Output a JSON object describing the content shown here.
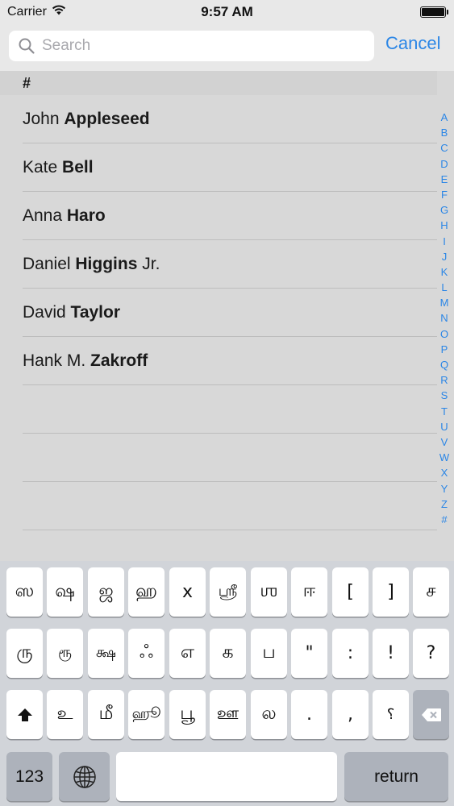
{
  "status_bar": {
    "carrier": "Carrier",
    "time": "9:57 AM"
  },
  "search": {
    "placeholder": "Search",
    "cancel_label": "Cancel"
  },
  "list": {
    "section_header": "#",
    "rows": [
      {
        "first": "John",
        "last": "Appleseed",
        "suffix": ""
      },
      {
        "first": "Kate",
        "last": "Bell",
        "suffix": ""
      },
      {
        "first": "Anna",
        "last": "Haro",
        "suffix": ""
      },
      {
        "first": "Daniel",
        "last": "Higgins",
        "suffix": "Jr."
      },
      {
        "first": "David",
        "last": "Taylor",
        "suffix": ""
      },
      {
        "first": "Hank M.",
        "last": "Zakroff",
        "suffix": ""
      },
      {
        "first": "",
        "last": "",
        "suffix": ""
      },
      {
        "first": "",
        "last": "",
        "suffix": ""
      },
      {
        "first": "",
        "last": "",
        "suffix": ""
      }
    ],
    "index_letters": [
      "A",
      "B",
      "C",
      "D",
      "E",
      "F",
      "G",
      "H",
      "I",
      "J",
      "K",
      "L",
      "M",
      "N",
      "O",
      "P",
      "Q",
      "R",
      "S",
      "T",
      "U",
      "V",
      "W",
      "X",
      "Y",
      "Z",
      "#"
    ]
  },
  "keyboard": {
    "row1": [
      "ஸ",
      "ஷ",
      "ஜ",
      "ஹ",
      "x",
      "ஶ்ரீ",
      "ஶ",
      "ஈ",
      "[",
      "]",
      "ச"
    ],
    "row2": [
      "ரு",
      "ரூ",
      "க்ஷ",
      "ஃ",
      "எ",
      "க",
      "ப",
      "\"",
      ":",
      "!",
      "?"
    ],
    "row3": [
      "உ",
      "மீ",
      "ஹூ",
      "பூ",
      "ஊ",
      "ல",
      ".",
      ",",
      "؟"
    ],
    "number_key": "123",
    "return_key": "return",
    "icons": {
      "shift": "shift-icon",
      "delete": "delete-icon",
      "globe": "globe-icon"
    }
  },
  "colors": {
    "accent": "#2b86e6",
    "list_background": "#d8d8d8",
    "keyboard_background": "#d1d4d9"
  }
}
